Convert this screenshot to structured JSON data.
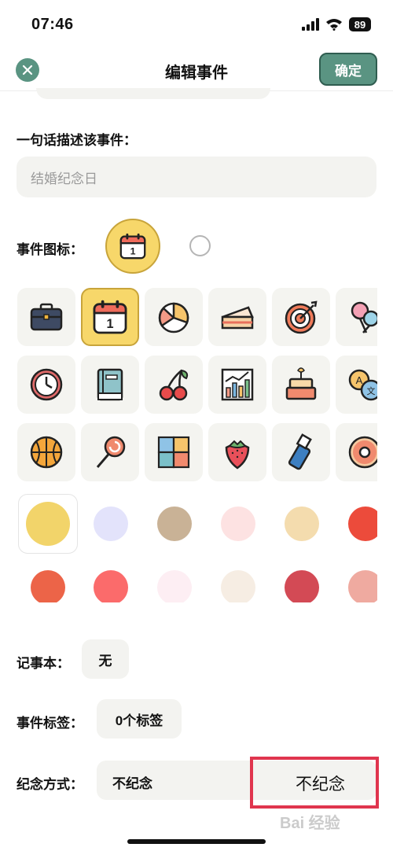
{
  "status_bar": {
    "time": "07:46",
    "battery": "89"
  },
  "header": {
    "title": "编辑事件",
    "confirm_label": "确定"
  },
  "description": {
    "label": "一句话描述该事件：",
    "value": "结婚纪念日"
  },
  "event_icon": {
    "label": "事件图标：",
    "selected_icon": "calendar-icon",
    "calendar_day": "1",
    "icons": [
      "briefcase-icon",
      "calendar-icon",
      "pie-chart-icon",
      "cake-slice-icon",
      "target-icon",
      "cotton-candy-icon",
      "clock-icon",
      "book-icon",
      "cherries-icon",
      "bar-chart-icon",
      "birthday-cake-icon",
      "translate-icon",
      "basketball-icon",
      "lollipop-icon",
      "puzzle-icon",
      "strawberry-icon",
      "usb-drive-icon",
      "donut-icon"
    ]
  },
  "colors": [
    "#f2d46a",
    "#e3e3fb",
    "#c9b296",
    "#fde2e2",
    "#f4dcae",
    "#ec4b3b",
    "#ec6448",
    "#fb6b6b",
    "#fdeef3",
    "#f6ede3",
    "#d34a55",
    "#efaaa0"
  ],
  "selected_color": "#f2d46a",
  "notebook": {
    "label": "记事本：",
    "value": "无"
  },
  "tags": {
    "label": "事件标签：",
    "value": "0个标签"
  },
  "remember": {
    "label": "纪念方式：",
    "value": "不纪念",
    "option": "不纪念"
  },
  "watermark": "Bai 经验"
}
